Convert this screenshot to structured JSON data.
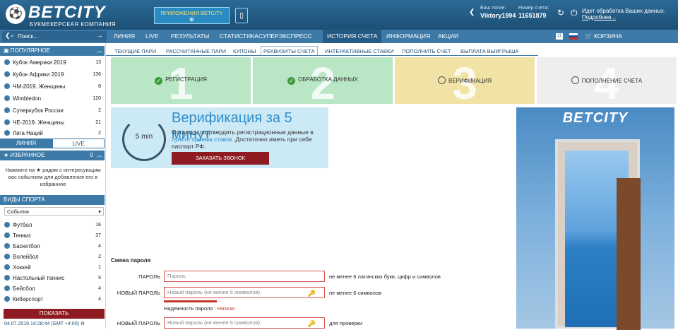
{
  "header": {
    "logo_name": "BETCITY",
    "logo_sub": "БУКМЕКЕРСКАЯ КОМПАНИЯ",
    "apps_label": "ПРИЛОЖЕНИЯ BETCITY",
    "apps_os": "⊞ ",
    "phone_icon": "▯",
    "login_label": "Ваш логин:",
    "login_value": "Viktory1994",
    "account_label": "Номер счета:",
    "account_value": "11651879",
    "notice": "Идет обработка Ваших данных.",
    "notice_link": "Подробнее..."
  },
  "nav": {
    "search_placeholder": "Поиск...",
    "items": [
      "ЛИНИЯ",
      "LIVE",
      "РЕЗУЛЬТАТЫ",
      "СТАТИСТИКА",
      "СУПЕРЭКСПРЕСС",
      "ИСТОРИЯ СЧЕТА",
      "ИНФОРМАЦИЯ",
      "АКЦИИ"
    ],
    "badge": "11",
    "cart": "КОРЗИНА"
  },
  "subnav": [
    "ТЕКУЩИЕ ПАРИ",
    "РАССЧИТАННЫЕ ПАРИ",
    "КУПОНЫ",
    "РЕКВИЗИТЫ СЧЕТА",
    "ИНТЕРАКТИВНЫЕ СТАВКИ",
    "ПОПОЛНИТЬ СЧЕТ",
    "ВЫПЛАТА ВЫИГРЫША"
  ],
  "sidebar": {
    "popular_title": "ПОПУЛЯРНОЕ",
    "popular": [
      {
        "name": "Кубок Америки 2019",
        "count": "13"
      },
      {
        "name": "Кубок Африки 2019",
        "count": "136"
      },
      {
        "name": "ЧМ-2019. Женщины",
        "count": "8"
      },
      {
        "name": "Wimbledon",
        "count": "120"
      },
      {
        "name": "Суперкубок России",
        "count": "2"
      },
      {
        "name": "ЧЕ-2019. Женщины",
        "count": "21"
      },
      {
        "name": "Лига Наций",
        "count": "2"
      }
    ],
    "tab_line": "ЛИНИЯ",
    "tab_live": "LIVE",
    "fav_title": "ИЗБРАННОЕ",
    "fav_count": "0",
    "fav_empty": "Нажмите на ★ рядом с интересующим вас событием для добавления его в избранное",
    "sports_title": "ВИДЫ СПОРТА",
    "sports_select": "События",
    "sports": [
      {
        "name": "Футбол",
        "count": "16"
      },
      {
        "name": "Теннис",
        "count": "37"
      },
      {
        "name": "Баскетбол",
        "count": "4"
      },
      {
        "name": "Волейбол",
        "count": "2"
      },
      {
        "name": "Хоккей",
        "count": "1"
      },
      {
        "name": "Настольный теннис",
        "count": "5"
      },
      {
        "name": "Бейсбол",
        "count": "4"
      },
      {
        "name": "Киберспорт",
        "count": "4"
      }
    ],
    "show_button": "ПОКАЗАТЬ",
    "clock": "04.07.2019 14:28:44 (GMT +4:00)"
  },
  "steps": [
    {
      "num": "1",
      "label": "РЕГИСТРАЦИЯ",
      "status": "done",
      "color": "#b9e6c5"
    },
    {
      "num": "2",
      "label": "ОБРАБОТКА ДАННЫХ",
      "status": "done",
      "color": "#b9e6c5"
    },
    {
      "num": "3",
      "label": "ВЕРИФИКАЦИЯ",
      "status": "pending",
      "color": "#f1e2a6"
    },
    {
      "num": "4",
      "label": "ПОПОЛНЕНИЕ СЧЕТА",
      "status": "pending",
      "color": "#eeeeee"
    }
  ],
  "verify": {
    "timer": "5 min",
    "title": "Верификация за 5 минут",
    "text1": "Осталось подтвердить регистрационные данные в ",
    "link": "пункте приема ставок",
    "text2": " .Достаточно иметь при себе паспорт РФ.",
    "button": "ЗАКАЗАТЬ ЗВОНОК"
  },
  "ad": {
    "logo": "BETCITY"
  },
  "password": {
    "title": "Смена пароля",
    "rows": [
      {
        "label": "ПАРОЛЬ",
        "placeholder": "Пароль",
        "hint": "не менее 6 латинских букв, цифр и символов"
      },
      {
        "label": "НОВЫЙ ПАРОЛЬ",
        "placeholder": "Новый пароль (не менее 6 символов)",
        "hint": "не менее 6 символов"
      },
      {
        "label": "НОВЫЙ ПАРОЛЬ",
        "placeholder": "Новый пароль (не менее 6 символов)",
        "hint": "для проверки"
      }
    ],
    "strength_label": "Надежность пароля : ",
    "strength_value": "Низкая"
  }
}
